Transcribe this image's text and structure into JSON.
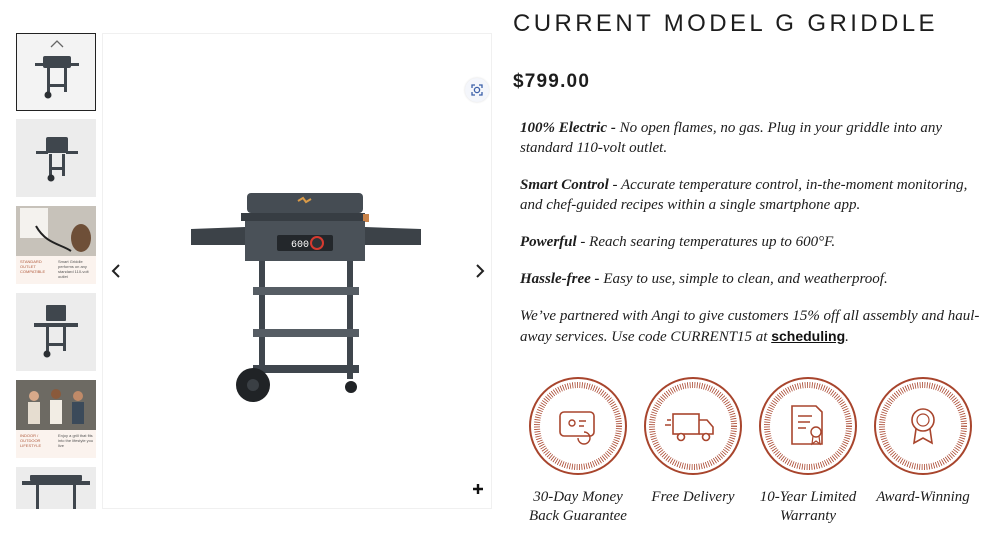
{
  "product": {
    "title": "CURRENT MODEL G GRIDDLE",
    "price": "$799.00"
  },
  "gallery": {
    "thumbnails": [
      {
        "name": "griddle-front",
        "active": true
      },
      {
        "name": "griddle-angle",
        "active": false
      },
      {
        "name": "promo-outlet",
        "active": false,
        "caption": "STANDARD OUTLET COMPATIBLE",
        "body": "Smart Griddle performs on any standard 110-volt outlet"
      },
      {
        "name": "griddle-open",
        "active": false
      },
      {
        "name": "promo-people",
        "active": false,
        "caption": "INDOOR / OUTDOOR LIFESTYLE",
        "body": "Enjoy a grill that fits into the lifestyle you live"
      },
      {
        "name": "griddle-side",
        "active": false
      }
    ],
    "display_readout": "600"
  },
  "features": [
    {
      "title": "100% Electric -",
      "text": " No open flames, no gas. Plug in your griddle into any standard 110-volt outlet."
    },
    {
      "title": "Smart Control",
      "text": " - Accurate temperature control, in-the-moment monitoring, and chef-guided recipes within a single smartphone app."
    },
    {
      "title": "Powerful",
      "text": " - Reach searing temperatures up to 600°F."
    },
    {
      "title": "Hassle-free -",
      "text": " Easy to use, simple to clean, and weatherproof."
    }
  ],
  "promo": {
    "text": "We’ve partnered with Angi to give customers 15% off all assembly and haul-away services. Use code CURRENT15 at ",
    "link_label": "scheduling",
    "end": "."
  },
  "badges": [
    {
      "icon": "money-back-icon",
      "label": "30-Day Money Back Guarantee"
    },
    {
      "icon": "delivery-truck-icon",
      "label": "Free Delivery"
    },
    {
      "icon": "warranty-certificate-icon",
      "label": "10-Year Limited Warranty"
    },
    {
      "icon": "award-ribbon-icon",
      "label": "Award-Winning"
    }
  ],
  "colors": {
    "badge_accent": "#a8452d",
    "griddle_body": "#3f464d"
  }
}
